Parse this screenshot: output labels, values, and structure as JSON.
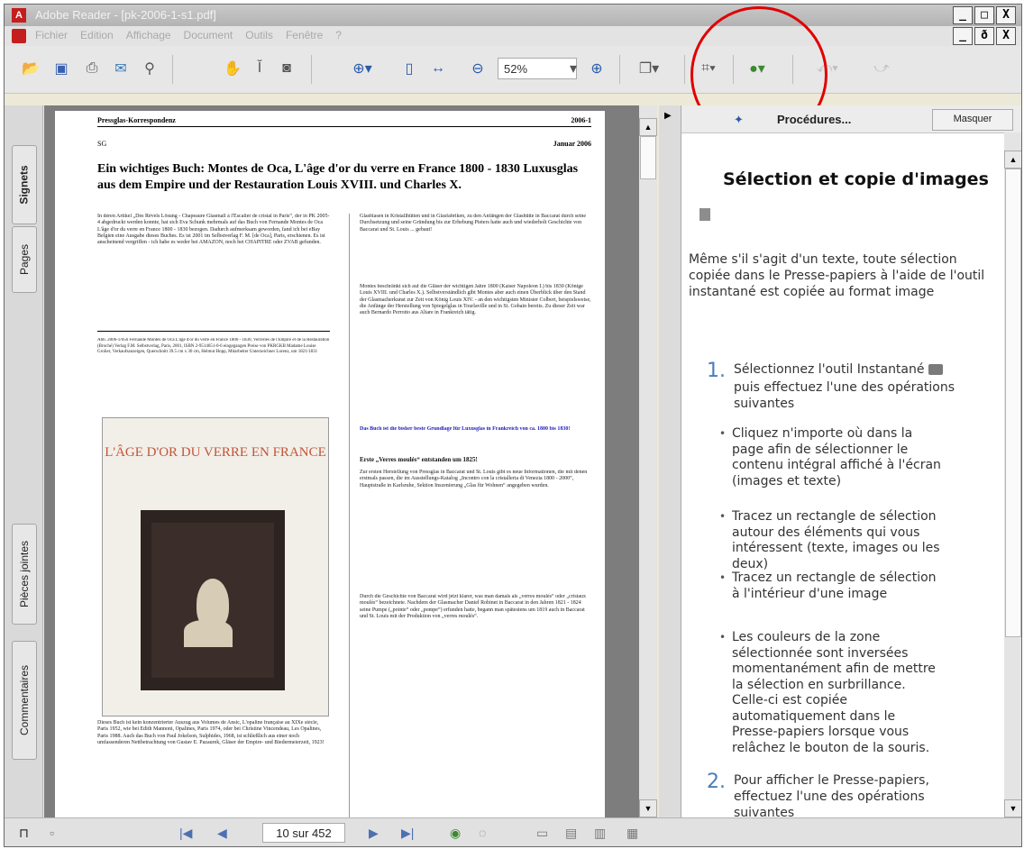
{
  "window": {
    "title": "Adobe Reader - [pk-2006-1-s1.pdf]",
    "minimize": "_",
    "maximize": "□",
    "close": "X",
    "doc_restore": "ð"
  },
  "menu": [
    "Fichier",
    "Edition",
    "Affichage",
    "Document",
    "Outils",
    "Fenêtre",
    "?"
  ],
  "toolbar": {
    "zoom_value": "52%"
  },
  "sidebar_tabs": [
    "Signets",
    "Pages",
    "Pièces jointes",
    "Commentaires"
  ],
  "document": {
    "header_left": "Pressglas-Korrespondenz",
    "header_right": "2006-1",
    "sub_left": "SG",
    "sub_right": "Januar 2006",
    "headline": "Ein wichtiges Buch: Montes de Oca, L'âge d'or du verre en France 1800 - 1830 Luxusglas aus dem Empire und der Restauration Louis XVIII. und Charles X.",
    "col1_text": "In deren Artikel „Des Rêvels Lösung - Chapeaure Glasmall à l'Escalier de cristal in Paris“, der in PK 2005-4 abgedruckt werden konnte, hat sich Eva Schunk mehrmals auf das Buch von Fernande Montes de Oca L'âge d'or du verre en France 1800 - 1830 bezogen. Dadurch aufmerksam geworden, fand ich bei eBay Belgien eine Ausgabe dieses Buches. Es ist 2001 im Selbstverlag F. M. [de Oca], Paris, erschienen. Es ist anscheinend vergriffen - ich habe es weder bei AMAZON, noch bei CHAPITRE oder ZVAB gefunden.",
    "biblio": "Abb. 2006-1/056 Fernande Montes de Oca L'âge d'or du verre en France 1800 - 1830, Verreries de l'Empire et de la Restauration (Broché) Verlag F.M. Selbstverlag, Paris, 2001, ISBN 2-9514651-0-6 eingegangen Preise von PKRGKB Madame Louise Grolier, Verkaufsanzeigen, Querschnitt 39.5 cm x 30 cm, Helmut Hopp, Mitarbeiter Unterzeichner Lorenz, um 1821/1831",
    "cover_title": "L'ÂGE D'OR DU VERRE EN FRANCE",
    "col1b_text": "Dieses Buch ist kein konzentrierter Auszug aus Volumes de Ansic, L'opaline française au XIXe siècle, Paris 1952, wie bei Edith Mannoni, Opalines, Paris 1974, oder bei Christine Vincendeau, Les Opalines, Paris 1988. Auch das Buch von Paul Jokelson, Sulphides, 1968, ist schließlich aus einer noch umfassenderen Nettbetrachtung von Gustav E. Pazaurek, Gläser der Empire- und Biedermeierzeit, 1923!",
    "col2a": "Glasblasen in Kristallhütten und in Glasfabriken, zu den Anfängen der Glashütte in Baccarat durch seine Durchsetzung und seine Gründung bis zur Erhebung Pieters hatte auch und wiederholt Geschichte von Baccarat und St. Louis ... gebaut!",
    "col2b": "Montes beschränkt sich auf die Gläser der wichtigen Jahre 1800 (Kaiser Napoleon I.) bis 1830 (Könige Louis XVIII. und Charles X.). Selbstverständlich gibt Montes aber auch einen Überblick über den Stand der Glasmacherkunst zur Zeit von König Louis XIV. - an den wichtigsten Minister Colbert, beispielsweise, die Anfänge der Herstellung von Spiegelglas in Tourlaville und in St. Gobain bereits. Zu dieser Zeit war auch Bernardo Perrotto aus Altare in Frankreich tätig.",
    "col2c": "Das Buch ist die bisher beste Grundlage für Luxusglas in Frankreich von ca. 1800 bis 1830!",
    "col2d_head": "Erste „Verres moulés“ entstanden um 1825!",
    "col2d": "Zur ersten Herstellung von Pressglas in Baccarat und St. Louis gibt es neue Informationen, die mit denen erstmals passen, die im Ausstellungs-Katalog „Incontro con la cristalleria di Venezia 1800 - 2000“, Hauptstraße in Karlsruhe, Sektion Inszenierung „Glas für Wohnen“ angegeben wurden.",
    "col2e": "Durch die Geschichte von Baccarat wird jetzt klarer, was man damals als „verres moulés“ oder „cristaux moulés“ bezeichnete. Nachdem der Glasmacher Daniel Robinet in Baccarat in den Jahren 1821 - 1824 seine Pumpe („pointe“ oder „pompe“) erfunden hatte, begann man spätestens um 1819 auch in Baccarat und St. Louis mit der Produktion von „verres moulés“."
  },
  "help": {
    "header": "Procédures...",
    "mask_button": "Masquer",
    "title": "Sélection et copie d'images",
    "intro": "Même s'il s'agit d'un texte, toute sélection copiée dans le Presse-papiers à l'aide de l'outil instantané est copiée au format image",
    "step1_num": "1.",
    "step1": "Sélectionnez l'outil Instantané",
    "step1b": "puis effectuez l'une des opérations suivantes",
    "bullets": [
      "Cliquez n'importe où dans la page afin de sélectionner le contenu intégral affiché à l'écran (images et texte)",
      "Tracez un rectangle de sélection autour des éléments qui vous intéressent (texte, images ou les deux)",
      "Tracez un rectangle de sélection à l'intérieur d'une image",
      "Les couleurs de la zone sélectionnée sont inversées momentanément afin de mettre la sélection en surbrillance. Celle-ci est copiée automatiquement dans le Presse-papiers lorsque vous relâchez le bouton de la souris."
    ],
    "step2_num": "2.",
    "step2": "Pour afficher le Presse-papiers, effectuez l'une des opérations suivantes"
  },
  "status": {
    "page_indicator": "10 sur 452"
  }
}
